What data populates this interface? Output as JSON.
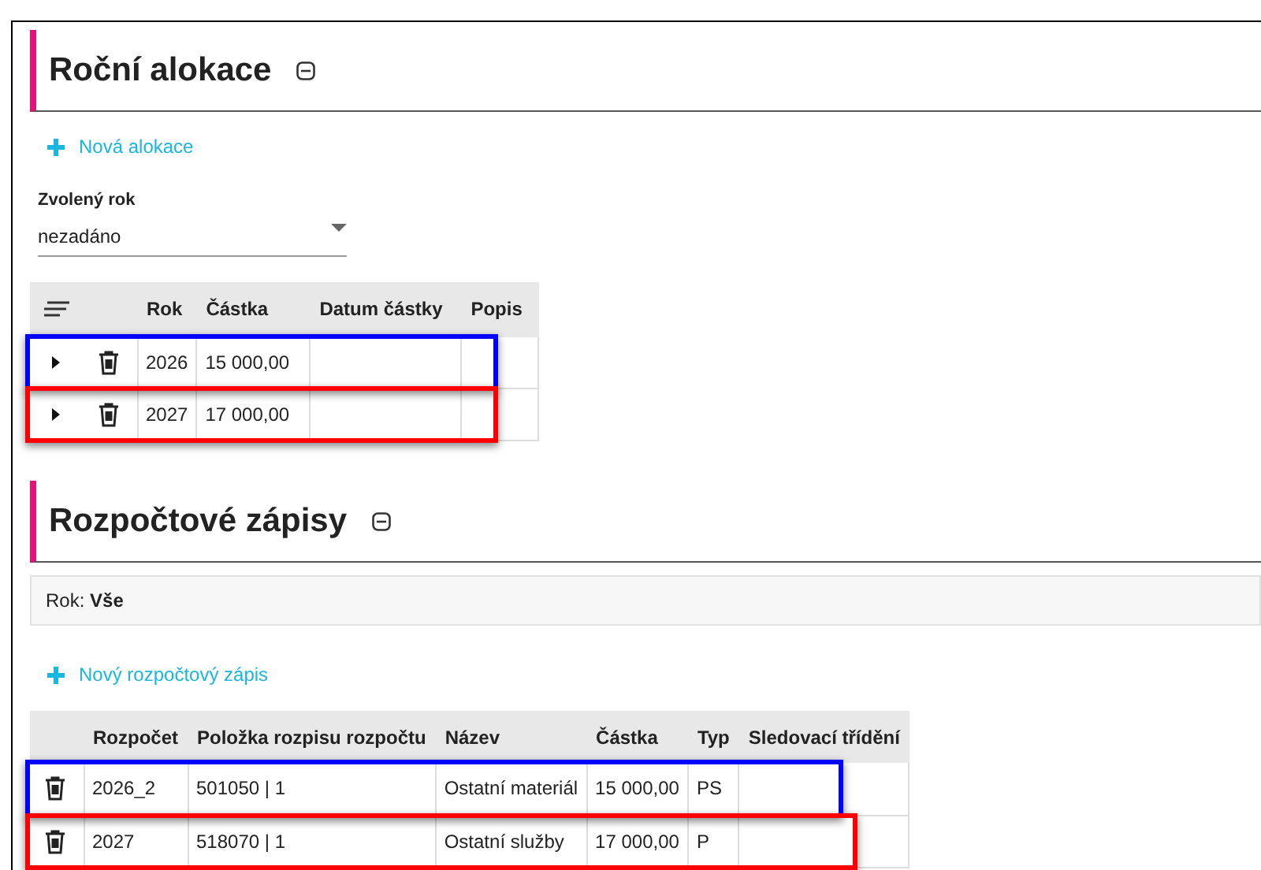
{
  "allocations": {
    "title": "Roční alokace",
    "new_button": "Nová alokace",
    "year_select": {
      "label": "Zvolený rok",
      "value": "nezadáno"
    },
    "columns": [
      "Rok",
      "Částka",
      "Datum částky",
      "Popis"
    ],
    "rows": [
      {
        "year": "2026",
        "amount": "15 000,00",
        "date": "",
        "note": "",
        "color": "#0000ff"
      },
      {
        "year": "2027",
        "amount": "17 000,00",
        "date": "",
        "note": "",
        "color": "#ff0000"
      }
    ]
  },
  "entries": {
    "title": "Rozpočtové zápisy",
    "filter": "Rok: **Vše**",
    "new_button": "Nový rozpočtový zápis",
    "columns": [
      "Rozpočet",
      "Položka rozpisu rozpočtu",
      "Název",
      "Částka",
      "Typ",
      "Sledovací třídění"
    ],
    "rows": [
      {
        "cells": [
          "2026_2",
          "501050 | 1",
          "Ostatní materiál",
          "15 000,00",
          "PS",
          ""
        ],
        "color": "#0000ff"
      },
      {
        "cells": [
          "2027",
          "518070 | 1",
          "Ostatní služby",
          "17 000,00",
          "P",
          ""
        ],
        "color": "#ff0000"
      }
    ]
  }
}
